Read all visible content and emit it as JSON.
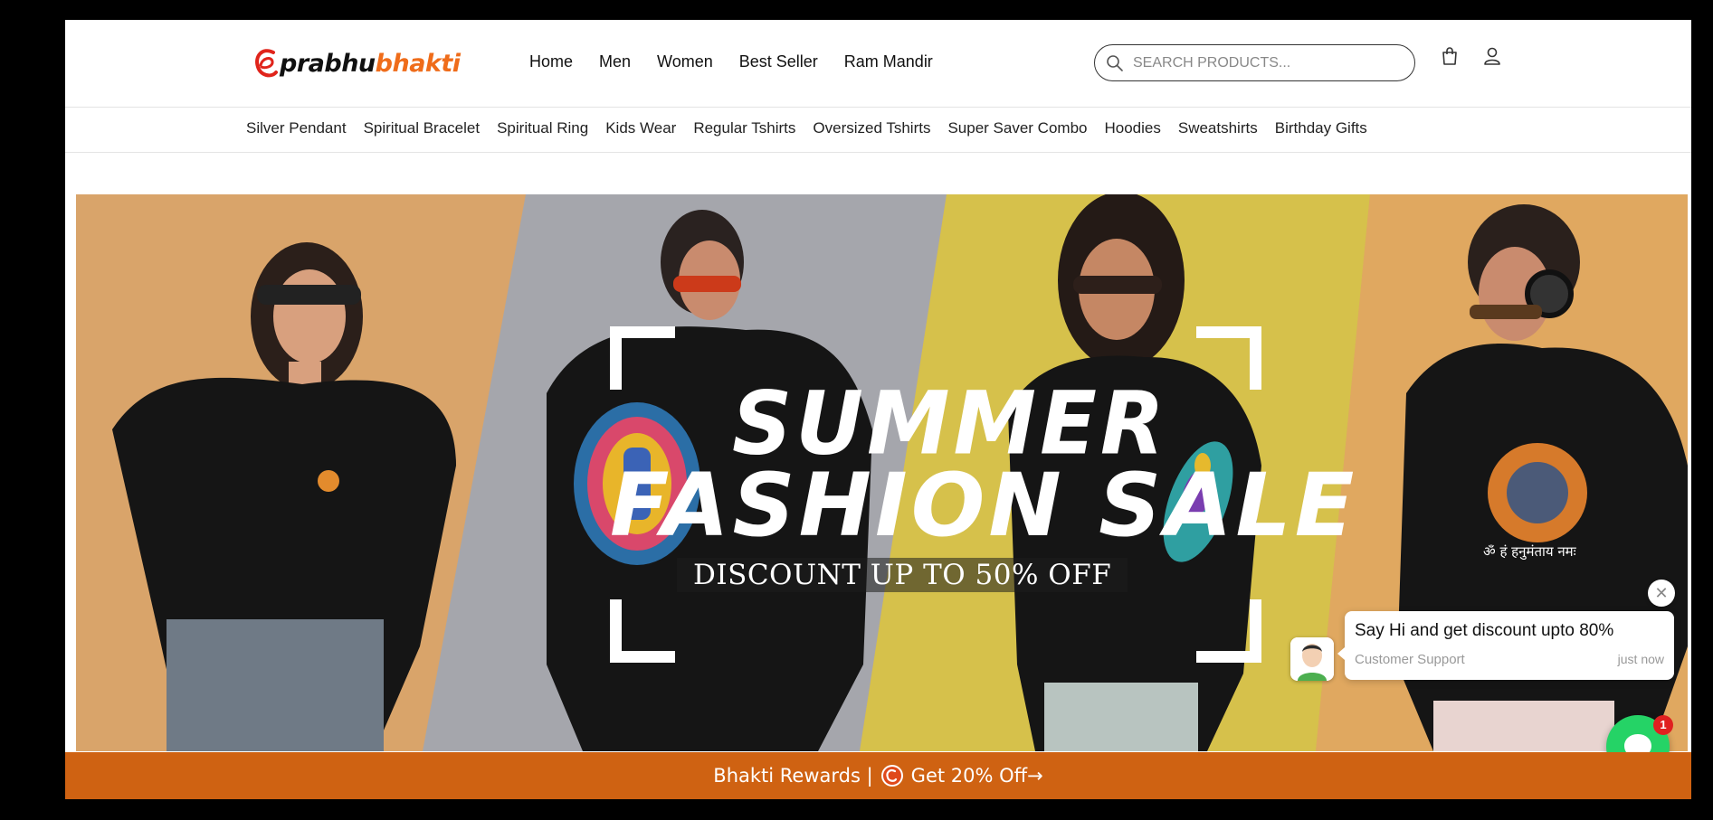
{
  "brand": {
    "name_part1": "prabhu",
    "name_part2": "bhakti",
    "primary_color": "#ef6c1a"
  },
  "main_nav": [
    "Home",
    "Men",
    "Women",
    "Best Seller",
    "Ram Mandir"
  ],
  "search": {
    "placeholder": "SEARCH PRODUCTS..."
  },
  "header_icons": [
    "shopping-bag-icon",
    "user-icon"
  ],
  "category_nav": [
    "Silver Pendant",
    "Spiritual Bracelet",
    "Spiritual Ring",
    "Kids Wear",
    "Regular Tshirts",
    "Oversized Tshirts",
    "Super Saver Combo",
    "Hoodies",
    "Sweatshirts",
    "Birthday Gifts"
  ],
  "hero": {
    "line1": "SUMMER",
    "line2": "FASHION SALE",
    "discount": "DISCOUNT UP TO 50% OFF",
    "tshirt_print": "ॐ हं हनुमंताय नमः"
  },
  "chat": {
    "message": "Say Hi and get discount upto 80%",
    "sender": "Customer Support",
    "time": "just now",
    "badge_count": "1",
    "close_symbol": "✕"
  },
  "rewards": {
    "label": "Bhakti Rewards |",
    "offer": "Get 20% Off→",
    "bar_color": "#cf6212"
  }
}
